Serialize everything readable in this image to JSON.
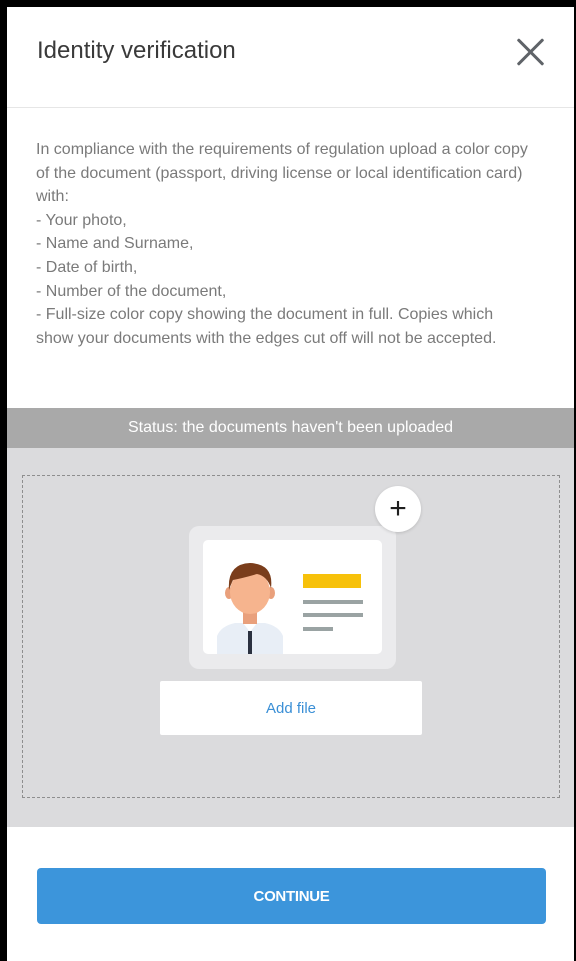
{
  "header": {
    "title": "Identity verification",
    "close_icon": "close-icon"
  },
  "description": {
    "lines": [
      "In compliance with the requirements of regulation upload a color copy of the document (passport, driving license or local identification card) with:",
      "- Your photo,",
      "- Name and Surname,",
      "- Date of birth,",
      "- Number of the document,",
      "- Full-size color copy showing the document in full. Copies which show your documents with the edges cut off will not be accepted."
    ]
  },
  "status": {
    "text": "Status: the documents haven't been uploaded"
  },
  "upload": {
    "illustration_icon": "id-card-icon",
    "add_icon": "plus-icon",
    "plus_symbol": "+",
    "add_file_label": "Add file"
  },
  "footer": {
    "continue_label": "CONTINUE"
  },
  "colors": {
    "primary": "#3c95db",
    "status_bg": "#a9a9a9",
    "upload_bg": "#dbdbdd",
    "accent_yellow": "#f7c10a",
    "link": "#3a8fd6"
  }
}
